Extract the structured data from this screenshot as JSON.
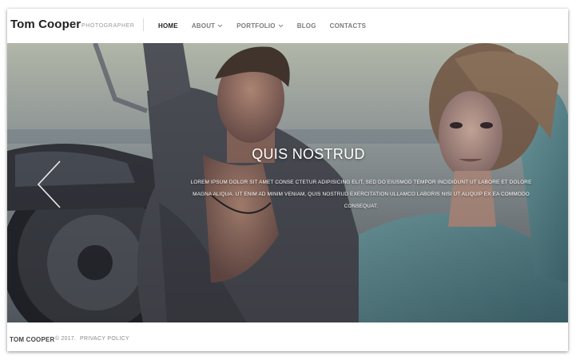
{
  "header": {
    "brand": "Tom Cooper",
    "tagline": "PHOTOGRAPHER",
    "nav": [
      {
        "label": "HOME",
        "active": true,
        "dropdown": false
      },
      {
        "label": "ABOUT",
        "active": false,
        "dropdown": true
      },
      {
        "label": "PORTFOLIO",
        "active": false,
        "dropdown": true
      },
      {
        "label": "BLOG",
        "active": false,
        "dropdown": false
      },
      {
        "label": "CONTACTS",
        "active": false,
        "dropdown": false
      }
    ]
  },
  "slide": {
    "title": "QUIS NOSTRUD",
    "text": "LOREM IPSUM DOLOR SIT AMET CONSE CTETUR ADIPISICING ELIT, SED DO EIUSMOD TEMPOR INCIDIDUNT UT LABORE ET DOLORE MAGNA ALIQUA. UT ENIM AD MINIM VENIAM, QUIS NOSTRUD EXERCITATION ULLAMCO LABORIS NISI UT ALIQUIP EX EA COMMODO CONSEQUAT.",
    "prev_icon": "chevron-left-icon"
  },
  "footer": {
    "brand": "TOM COOPER",
    "copyright": "© 2017.",
    "privacy": "PRIVACY POLICY"
  },
  "colors": {
    "text_dark": "#1f1f1f",
    "nav_inactive": "#7c7c7c",
    "hero_overlay": "#5e646e"
  }
}
